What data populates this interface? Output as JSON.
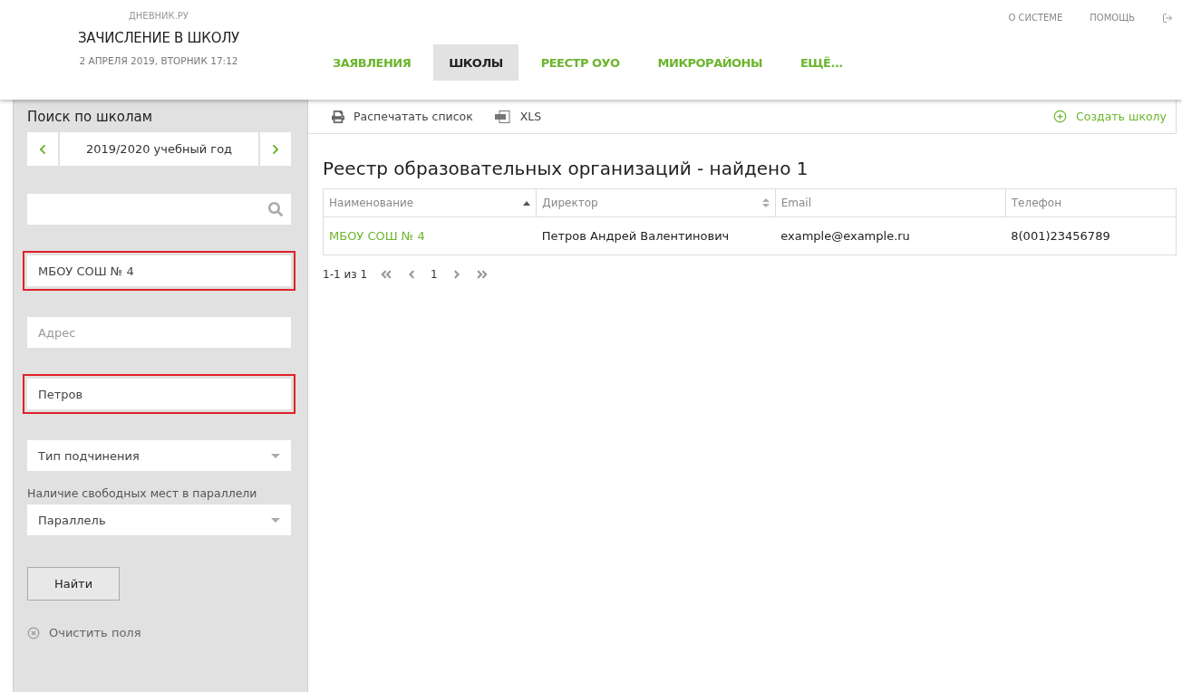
{
  "header": {
    "brand": "ДНЕВНИК.РУ",
    "title": "ЗАЧИСЛЕНИЕ В ШКОЛУ",
    "datetime": "2 АПРЕЛЯ 2019, ВТОРНИК 17:12",
    "nav": [
      {
        "label": "ЗАЯВЛЕНИЯ",
        "selected": false
      },
      {
        "label": "ШКОЛЫ",
        "selected": true
      },
      {
        "label": "РЕЕСТР ОУО",
        "selected": false
      },
      {
        "label": "МИКРОРАЙОНЫ",
        "selected": false
      },
      {
        "label": "ЕЩЁ...",
        "selected": false
      }
    ],
    "links": [
      "О СИСТЕМЕ",
      "ПОМОЩЬ"
    ]
  },
  "sidebar": {
    "title": "Поиск по школам",
    "year": "2019/2020 учебный год",
    "fields": [
      {
        "kind": "search",
        "highlighted": false
      },
      {
        "kind": "text",
        "value": "МБОУ СОШ № 4",
        "highlighted": true
      },
      {
        "kind": "text",
        "placeholder": "Адрес",
        "highlighted": false
      },
      {
        "kind": "text",
        "value": "Петров",
        "highlighted": true
      },
      {
        "kind": "select",
        "value": "Тип подчинения",
        "highlighted": false
      },
      {
        "kind": "label",
        "text": "Наличие свободных мест в параллели"
      },
      {
        "kind": "select",
        "value": "Параллель",
        "highlighted": false
      }
    ],
    "find_button": "Найти",
    "clear_link": "Очистить поля"
  },
  "toolbar": {
    "print": "Распечатать список",
    "xls": "XLS",
    "create": "Создать школу"
  },
  "heading": "Реестр образовательных организаций - найдено 1",
  "table": {
    "columns": [
      {
        "label": "Наименование",
        "sorted": true,
        "sortable": true
      },
      {
        "label": "Директор",
        "sorted": false,
        "sortable": true
      },
      {
        "label": "Email",
        "sorted": false,
        "sortable": false
      },
      {
        "label": "Телефон",
        "sorted": false,
        "sortable": false
      }
    ],
    "rows": [
      [
        "МБОУ СОШ № 4",
        "Петров Андрей Валентинович",
        "example@example.ru",
        "8(001)23456789"
      ]
    ]
  },
  "pagination": {
    "range": "1-1 из 1",
    "page": "1"
  }
}
